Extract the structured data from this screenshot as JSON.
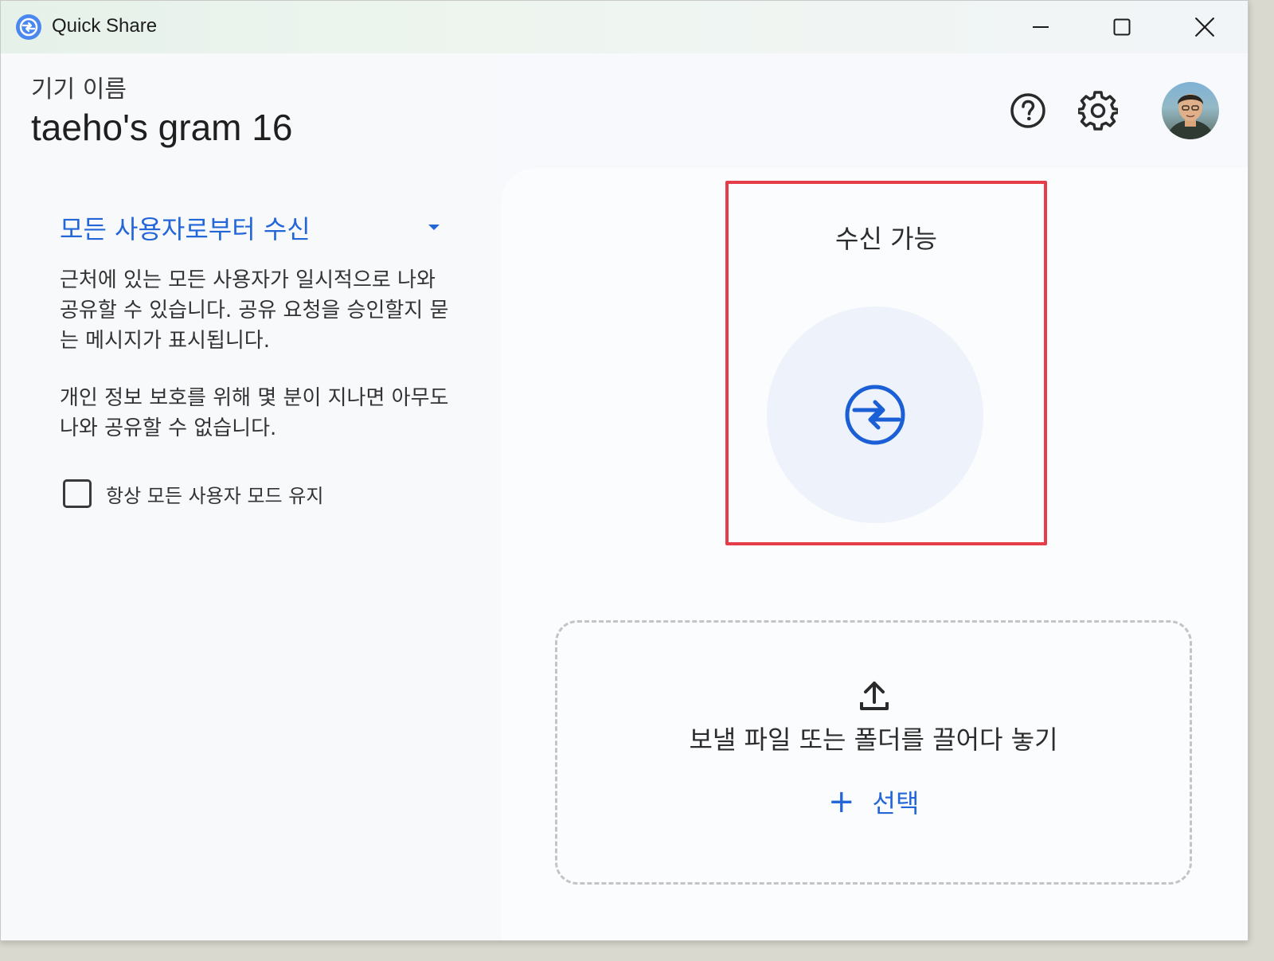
{
  "window": {
    "title": "Quick Share",
    "minimize_icon": "minimize-icon",
    "maximize_icon": "maximize-icon",
    "close_icon": "close-icon"
  },
  "device": {
    "label": "기기 이름",
    "name": "taeho's gram 16"
  },
  "header_actions": {
    "help_icon": "help-circle-icon",
    "settings_icon": "gear-icon",
    "avatar": "user-avatar"
  },
  "visibility": {
    "selected_mode": "모든 사용자로부터 수신",
    "description_1": "근처에 있는 모든 사용자가 일시적으로 나와 공유할 수 있습니다. 공유 요청을 승인할지 묻는 메시지가 표시됩니다.",
    "description_2": "개인 정보 보호를 위해 몇 분이 지나면 아무도 나와 공유할 수 없습니다.",
    "checkbox_label": "항상 모든 사용자 모드 유지",
    "checkbox_checked": false
  },
  "receive": {
    "status_label": "수신 가능",
    "icon": "quick-share-sync-icon"
  },
  "send": {
    "drop_text": "보낼 파일 또는 폴더를 끌어다 놓기",
    "select_label": "선택",
    "upload_icon": "upload-icon",
    "plus_icon": "plus-icon"
  },
  "colors": {
    "accent": "#2266d8",
    "highlight_border": "#e53e4a",
    "background": "#f7f9fc"
  }
}
